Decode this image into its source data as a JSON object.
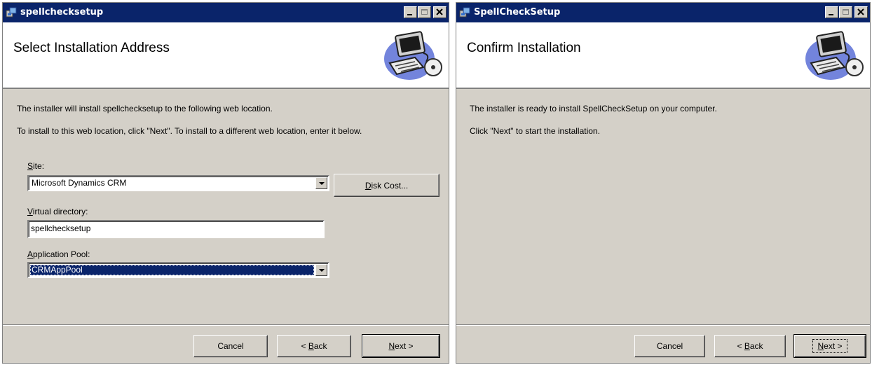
{
  "left_window": {
    "title": "spellchecksetup",
    "banner_title": "Select Installation Address",
    "line1": "The installer will install spellchecksetup to the following web location.",
    "line2": "To install to this web location, click \"Next\". To install to a different web location, enter it below.",
    "site": {
      "label_key": "S",
      "label_rest": "ite:",
      "value": "Microsoft Dynamics CRM"
    },
    "disk_cost": {
      "key": "D",
      "rest": "isk Cost..."
    },
    "virtual_directory": {
      "label_key": "V",
      "label_rest": "irtual directory:",
      "value": "spellchecksetup"
    },
    "application_pool": {
      "label_key": "A",
      "label_rest": "pplication Pool:",
      "value": "CRMAppPool"
    },
    "buttons": {
      "cancel": "Cancel",
      "back_prefix": "< ",
      "back_key": "B",
      "back_rest": "ack",
      "next_key": "N",
      "next_rest": "ext >"
    }
  },
  "right_window": {
    "title": "SpellCheckSetup",
    "banner_title": "Confirm Installation",
    "line1": "The installer is ready to install SpellCheckSetup on your computer.",
    "line2": "Click \"Next\" to start the installation.",
    "buttons": {
      "cancel": "Cancel",
      "back_prefix": "< ",
      "back_key": "B",
      "back_rest": "ack",
      "next_key": "N",
      "next_rest": "ext >"
    }
  },
  "icons": {
    "app": "installer-app-icon",
    "minimize": "minimize-icon",
    "maximize": "maximize-icon",
    "close": "close-icon",
    "banner": "computer-with-cd-icon"
  },
  "colors": {
    "titlebar": "#0a246a",
    "dialog_face": "#d4d0c8",
    "selection": "#0a246a"
  }
}
